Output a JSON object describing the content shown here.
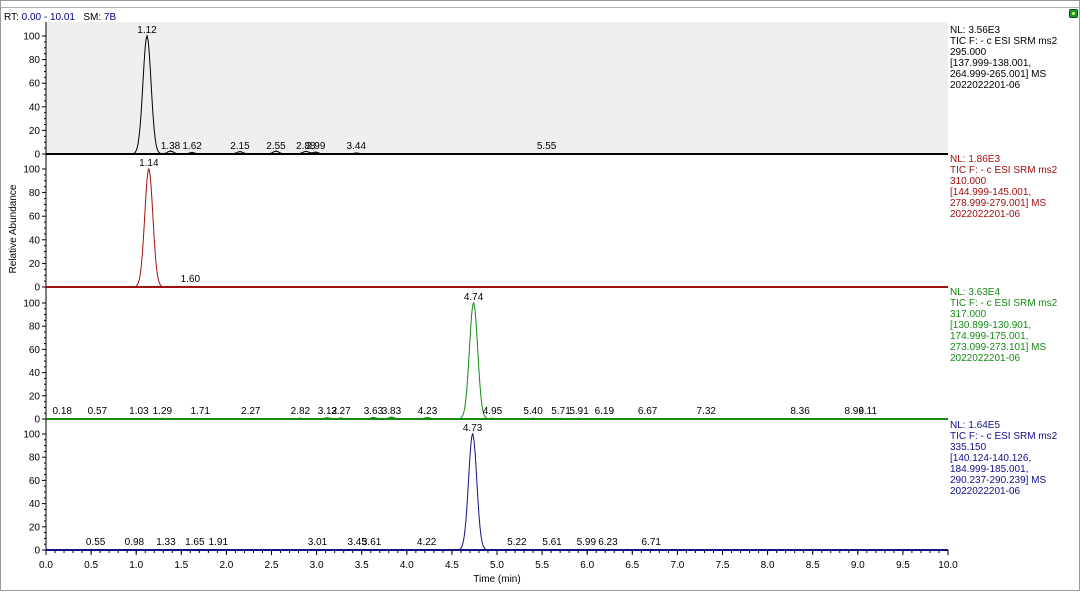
{
  "header": {
    "rt_label": "RT:",
    "rt_range": "0.00 - 10.01",
    "sm_label": "SM:",
    "sm_value": "7B"
  },
  "status_icon": "green-status-icon",
  "chart_data": {
    "type": "line",
    "ylabel": "Relative Abundance",
    "xlabel": "Time (min)",
    "xlim": [
      0.0,
      10.0
    ],
    "xticks": [
      "0.0",
      "0.5",
      "1.0",
      "1.5",
      "2.0",
      "2.5",
      "3.0",
      "3.5",
      "4.0",
      "4.5",
      "5.0",
      "5.5",
      "6.0",
      "6.5",
      "7.0",
      "7.5",
      "8.0",
      "8.5",
      "9.0",
      "9.5",
      "10.0"
    ],
    "yticks": [
      "0",
      "20",
      "40",
      "60",
      "80",
      "100"
    ],
    "ylim": [
      0,
      100
    ],
    "panels": [
      {
        "color": "#000000",
        "shaded": true,
        "info": [
          "NL: 3.56E3",
          "TIC F: - c ESI SRM ms2",
          "295.000",
          "[137.999-138.001,",
          "264.999-265.001]  MS",
          "2022022201-06"
        ],
        "peaks": [
          {
            "rt": 1.12,
            "y": 100,
            "label": "1.12"
          },
          {
            "rt": 1.38,
            "y": 2.5,
            "label": "1.38"
          },
          {
            "rt": 1.62,
            "y": 1.2,
            "label": "1.62"
          },
          {
            "rt": 2.15,
            "y": 2.0,
            "label": "2.15"
          },
          {
            "rt": 2.55,
            "y": 2.4,
            "label": "2.55"
          },
          {
            "rt": 2.88,
            "y": 2.2,
            "label": "2.88"
          },
          {
            "rt": 2.99,
            "y": 1.5,
            "label": "2.99"
          },
          {
            "rt": 3.44,
            "y": 0.8,
            "label": "3.44"
          },
          {
            "rt": 5.55,
            "y": 0.3,
            "label": "5.55"
          }
        ]
      },
      {
        "color": "#a01010",
        "shaded": false,
        "info": [
          "NL: 1.86E3",
          "TIC F: - c ESI SRM ms2",
          "310.000",
          "[144.999-145.001,",
          "278.999-279.001]  MS",
          "2022022201-06"
        ],
        "peaks": [
          {
            "rt": 1.14,
            "y": 100,
            "label": "1.14"
          },
          {
            "rt": 1.6,
            "y": 0.4,
            "label": "1.60"
          }
        ]
      },
      {
        "color": "#158a15",
        "shaded": false,
        "info": [
          "NL: 3.63E4",
          "TIC F: - c ESI SRM ms2",
          "317.000",
          "[130.899-130.901,",
          "174.999-175.001,",
          "273.099-273.101]  MS",
          "2022022201-06"
        ],
        "peaks": [
          {
            "rt": 0.18,
            "y": 0.3,
            "label": "0.18"
          },
          {
            "rt": 0.57,
            "y": 0.3,
            "label": "0.57"
          },
          {
            "rt": 1.03,
            "y": 0.4,
            "label": "1.03"
          },
          {
            "rt": 1.29,
            "y": 0.5,
            "label": "1.29"
          },
          {
            "rt": 1.71,
            "y": 0.4,
            "label": "1.71"
          },
          {
            "rt": 2.27,
            "y": 0.4,
            "label": "2.27"
          },
          {
            "rt": 2.82,
            "y": 0.6,
            "label": "2.82"
          },
          {
            "rt": 3.12,
            "y": 1.0,
            "label": "3.12"
          },
          {
            "rt": 3.27,
            "y": 0.8,
            "label": "3.27"
          },
          {
            "rt": 3.63,
            "y": 1.3,
            "label": "3.63"
          },
          {
            "rt": 3.83,
            "y": 1.6,
            "label": "3.83"
          },
          {
            "rt": 4.23,
            "y": 1.2,
            "label": "4.23"
          },
          {
            "rt": 4.74,
            "y": 100,
            "label": "4.74"
          },
          {
            "rt": 4.95,
            "y": 0.6,
            "label": "4.95"
          },
          {
            "rt": 5.4,
            "y": 0.5,
            "label": "5.40"
          },
          {
            "rt": 5.71,
            "y": 0.5,
            "label": "5.71"
          },
          {
            "rt": 5.91,
            "y": 0.5,
            "label": "5.91"
          },
          {
            "rt": 6.19,
            "y": 0.4,
            "label": "6.19"
          },
          {
            "rt": 6.67,
            "y": 0.4,
            "label": "6.67"
          },
          {
            "rt": 7.32,
            "y": 0.3,
            "label": "7.32"
          },
          {
            "rt": 8.36,
            "y": 0.3,
            "label": "8.36"
          },
          {
            "rt": 8.96,
            "y": 0.3,
            "label": "8.96"
          },
          {
            "rt": 9.11,
            "y": 0.3,
            "label": "9.11"
          }
        ]
      },
      {
        "color": "#10108a",
        "shaded": false,
        "info": [
          "NL: 1.64E5",
          "TIC F: - c ESI SRM ms2",
          "335.150",
          "[140.124-140.126,",
          "184.999-185.001,",
          "290.237-290.239]  MS",
          "2022022201-06"
        ],
        "peaks": [
          {
            "rt": 0.55,
            "y": 0.2,
            "label": "0.55"
          },
          {
            "rt": 0.98,
            "y": 0.2,
            "label": "0.98"
          },
          {
            "rt": 1.33,
            "y": 0.2,
            "label": "1.33"
          },
          {
            "rt": 1.65,
            "y": 0.2,
            "label": "1.65"
          },
          {
            "rt": 1.91,
            "y": 0.2,
            "label": "1.91"
          },
          {
            "rt": 3.01,
            "y": 0.2,
            "label": "3.01"
          },
          {
            "rt": 3.45,
            "y": 0.2,
            "label": "3.45"
          },
          {
            "rt": 3.61,
            "y": 0.2,
            "label": "3.61"
          },
          {
            "rt": 4.22,
            "y": 0.2,
            "label": "4.22"
          },
          {
            "rt": 4.73,
            "y": 100,
            "label": "4.73"
          },
          {
            "rt": 5.22,
            "y": 0.2,
            "label": "5.22"
          },
          {
            "rt": 5.61,
            "y": 0.2,
            "label": "5.61"
          },
          {
            "rt": 5.99,
            "y": 0.2,
            "label": "5.99"
          },
          {
            "rt": 6.23,
            "y": 0.2,
            "label": "6.23"
          },
          {
            "rt": 6.71,
            "y": 0.2,
            "label": "6.71"
          }
        ]
      }
    ]
  }
}
